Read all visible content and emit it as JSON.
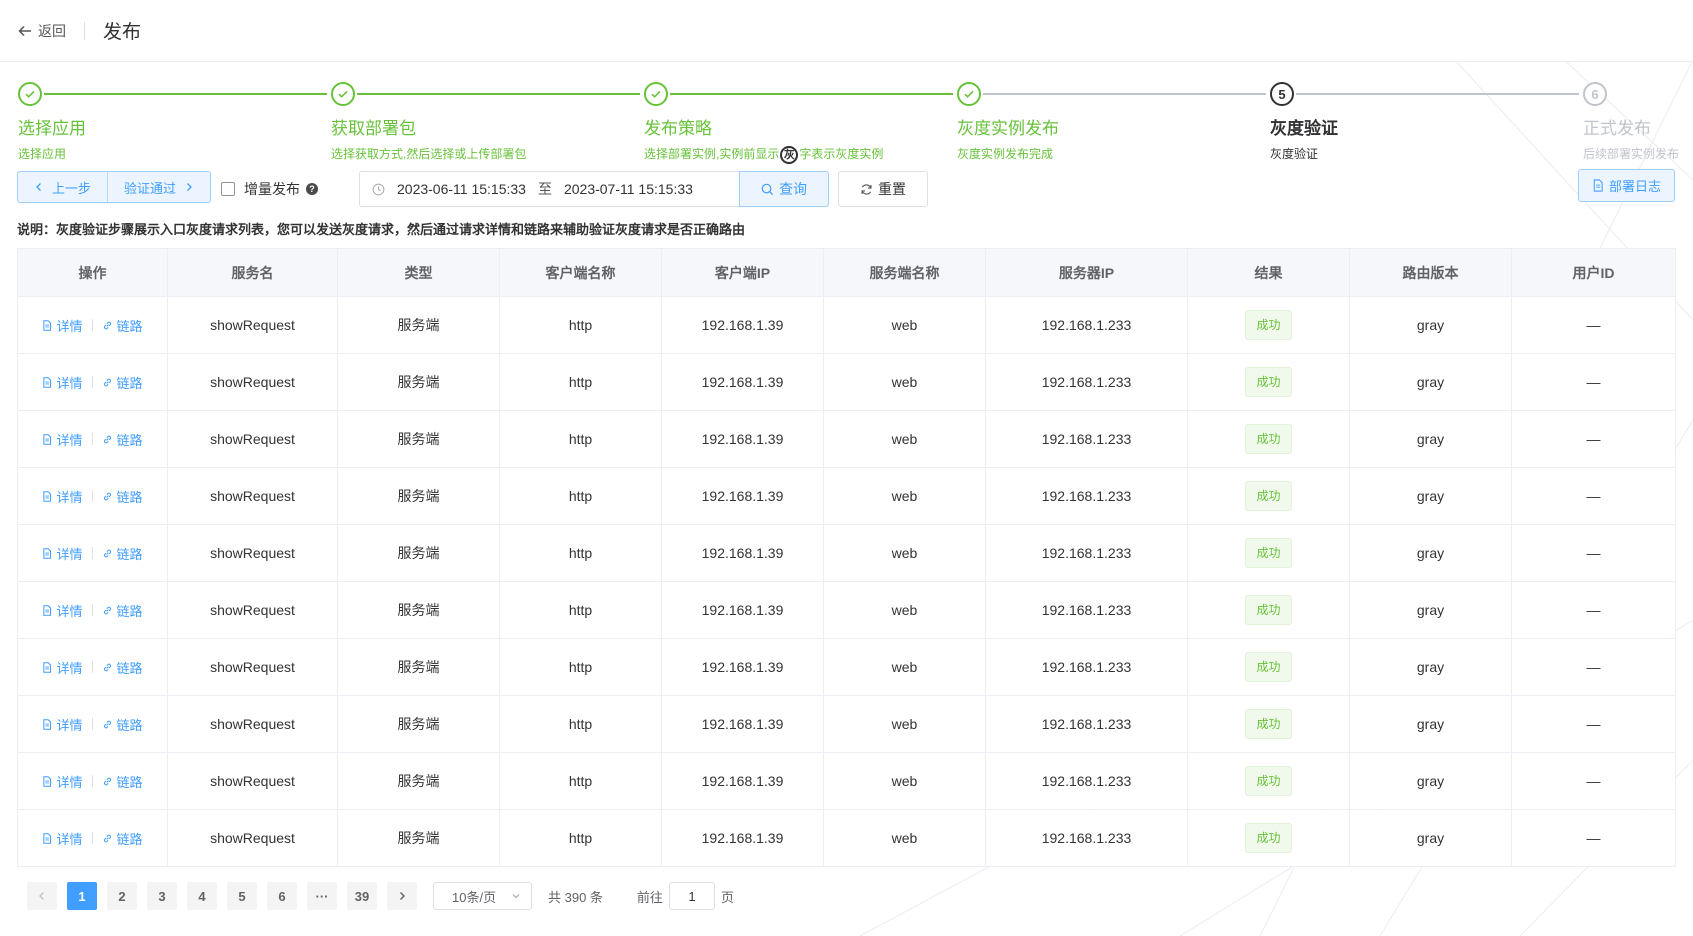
{
  "header": {
    "back_label": "返回",
    "title": "发布"
  },
  "steps": [
    {
      "number": "1",
      "title": "选择应用",
      "desc": "选择应用",
      "status": "done"
    },
    {
      "number": "2",
      "title": "获取部署包",
      "desc": "选择获取方式,然后选择或上传部署包",
      "status": "done"
    },
    {
      "number": "3",
      "title": "发布策略",
      "desc_before": "选择部署实例,实例前显示",
      "desc_badge": "灰",
      "desc_after": "字表示灰度实例",
      "status": "done"
    },
    {
      "number": "4",
      "title": "灰度实例发布",
      "desc": "灰度实例发布完成",
      "status": "done"
    },
    {
      "number": "5",
      "title": "灰度验证",
      "desc": "灰度验证",
      "status": "current"
    },
    {
      "number": "6",
      "title": "正式发布",
      "desc": "后续部署实例发布",
      "status": "wait"
    }
  ],
  "toolbar": {
    "prev_label": "上一步",
    "next_label": "验证通过",
    "incremental_label": "增量发布",
    "incremental_help": "?",
    "date_start": "2023-06-11 15:15:33",
    "date_sep": "至",
    "date_end": "2023-07-11 15:15:33",
    "query_label": "查询",
    "reset_label": "重置",
    "log_label": "部署日志"
  },
  "note": "说明：灰度验证步骤展示入口灰度请求列表，您可以发送灰度请求，然后通过请求详情和链路来辅助验证灰度请求是否正确路由",
  "table": {
    "columns": [
      "操作",
      "服务名",
      "类型",
      "客户端名称",
      "客户端IP",
      "服务端名称",
      "服务器IP",
      "结果",
      "路由版本",
      "用户ID"
    ],
    "action_detail": "详情",
    "action_trace": "链路",
    "rows": [
      {
        "service": "showRequest",
        "type": "服务端",
        "client_name": "http",
        "client_ip": "192.168.1.39",
        "server_name": "web",
        "server_ip": "192.168.1.233",
        "result": "成功",
        "route_version": "gray",
        "user_id": "—"
      },
      {
        "service": "showRequest",
        "type": "服务端",
        "client_name": "http",
        "client_ip": "192.168.1.39",
        "server_name": "web",
        "server_ip": "192.168.1.233",
        "result": "成功",
        "route_version": "gray",
        "user_id": "—"
      },
      {
        "service": "showRequest",
        "type": "服务端",
        "client_name": "http",
        "client_ip": "192.168.1.39",
        "server_name": "web",
        "server_ip": "192.168.1.233",
        "result": "成功",
        "route_version": "gray",
        "user_id": "—"
      },
      {
        "service": "showRequest",
        "type": "服务端",
        "client_name": "http",
        "client_ip": "192.168.1.39",
        "server_name": "web",
        "server_ip": "192.168.1.233",
        "result": "成功",
        "route_version": "gray",
        "user_id": "—"
      },
      {
        "service": "showRequest",
        "type": "服务端",
        "client_name": "http",
        "client_ip": "192.168.1.39",
        "server_name": "web",
        "server_ip": "192.168.1.233",
        "result": "成功",
        "route_version": "gray",
        "user_id": "—"
      },
      {
        "service": "showRequest",
        "type": "服务端",
        "client_name": "http",
        "client_ip": "192.168.1.39",
        "server_name": "web",
        "server_ip": "192.168.1.233",
        "result": "成功",
        "route_version": "gray",
        "user_id": "—"
      },
      {
        "service": "showRequest",
        "type": "服务端",
        "client_name": "http",
        "client_ip": "192.168.1.39",
        "server_name": "web",
        "server_ip": "192.168.1.233",
        "result": "成功",
        "route_version": "gray",
        "user_id": "—"
      },
      {
        "service": "showRequest",
        "type": "服务端",
        "client_name": "http",
        "client_ip": "192.168.1.39",
        "server_name": "web",
        "server_ip": "192.168.1.233",
        "result": "成功",
        "route_version": "gray",
        "user_id": "—"
      },
      {
        "service": "showRequest",
        "type": "服务端",
        "client_name": "http",
        "client_ip": "192.168.1.39",
        "server_name": "web",
        "server_ip": "192.168.1.233",
        "result": "成功",
        "route_version": "gray",
        "user_id": "—"
      },
      {
        "service": "showRequest",
        "type": "服务端",
        "client_name": "http",
        "client_ip": "192.168.1.39",
        "server_name": "web",
        "server_ip": "192.168.1.233",
        "result": "成功",
        "route_version": "gray",
        "user_id": "—"
      }
    ]
  },
  "pagination": {
    "pages": [
      "1",
      "2",
      "3",
      "4",
      "5",
      "6"
    ],
    "more": "···",
    "last_page": "39",
    "current": "1",
    "page_size": "10条/页",
    "total": "共 390 条",
    "goto_prefix": "前往",
    "goto_value": "1",
    "goto_suffix": "页"
  },
  "colors": {
    "primary": "#409eff",
    "success": "#67c23a",
    "text": "#333333",
    "wait": "#c0c4cc"
  },
  "icons": [
    "back-arrow-icon",
    "check-icon",
    "chevron-left-icon",
    "chevron-right-icon",
    "help-icon",
    "clock-icon",
    "search-icon",
    "refresh-icon",
    "document-icon",
    "link-icon",
    "chevron-down-icon"
  ]
}
